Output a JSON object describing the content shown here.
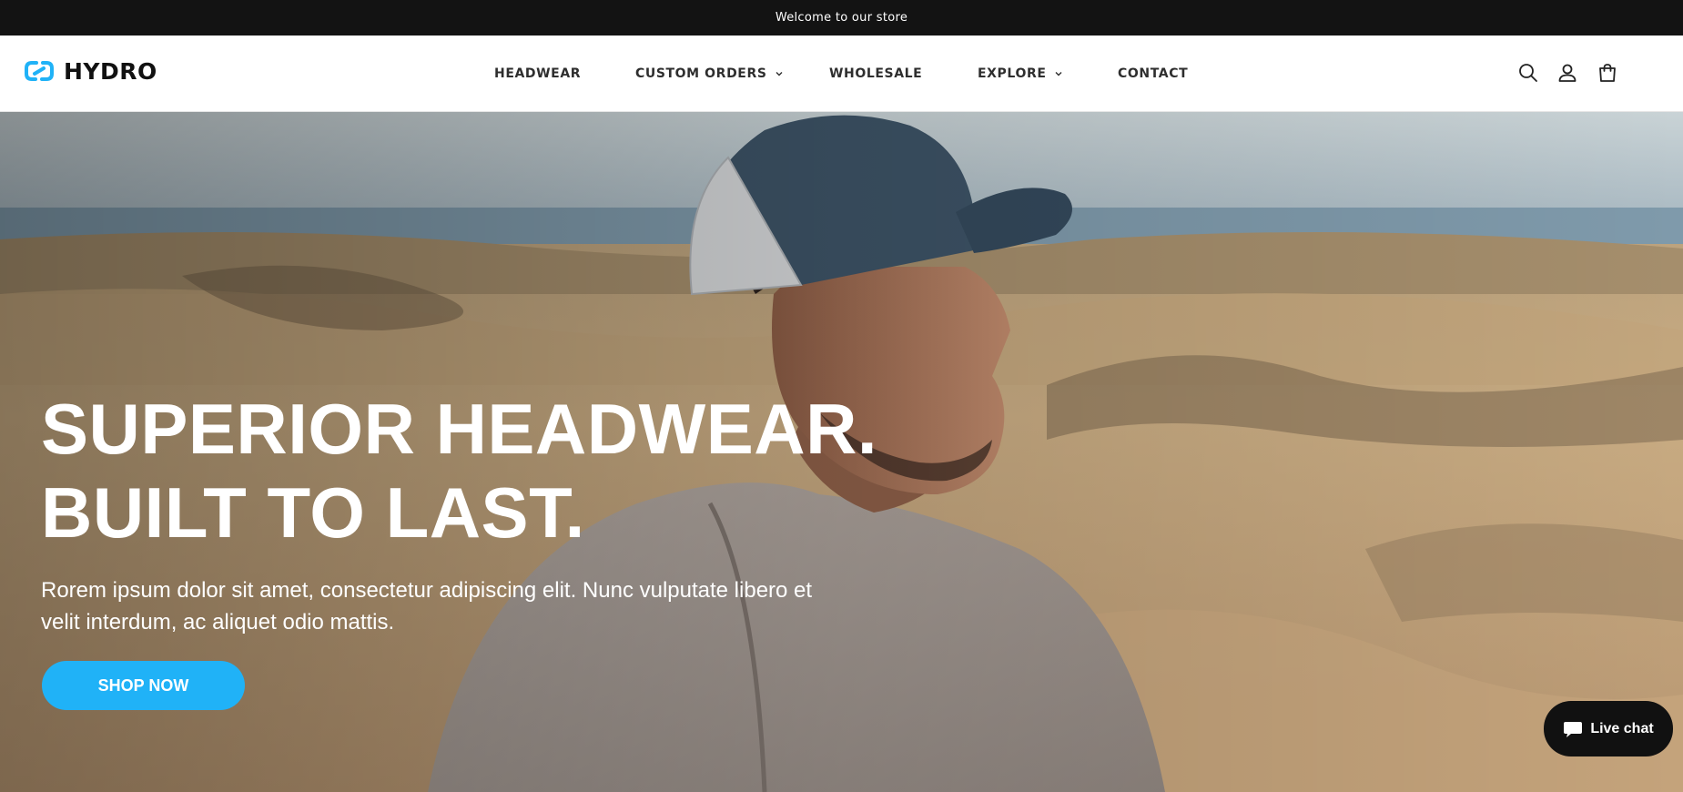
{
  "announcement": {
    "text": "Welcome to our store"
  },
  "header": {
    "logo_text": "HYDRO",
    "brand_color": "#20b2f7",
    "nav": [
      {
        "label": "HEADWEAR",
        "has_dropdown": false
      },
      {
        "label": "CUSTOM ORDERS",
        "has_dropdown": true
      },
      {
        "label": "WHOLESALE",
        "has_dropdown": false
      },
      {
        "label": "EXPLORE",
        "has_dropdown": true
      },
      {
        "label": "CONTACT",
        "has_dropdown": false
      }
    ],
    "icons": [
      "search-icon",
      "account-icon",
      "cart-icon"
    ]
  },
  "hero": {
    "title_line1": "SUPERIOR HEADWEAR.",
    "title_line2": "BUILT TO LAST.",
    "subtitle": "Rorem ipsum dolor sit amet, consectetur adipiscing elit. Nunc vulputate libero et velit interdum, ac aliquet odio mattis.",
    "cta_label": "SHOP NOW",
    "cta_color": "#20b2f7"
  },
  "chat": {
    "label": "Live chat",
    "icon": "chat-bubble-icon"
  }
}
